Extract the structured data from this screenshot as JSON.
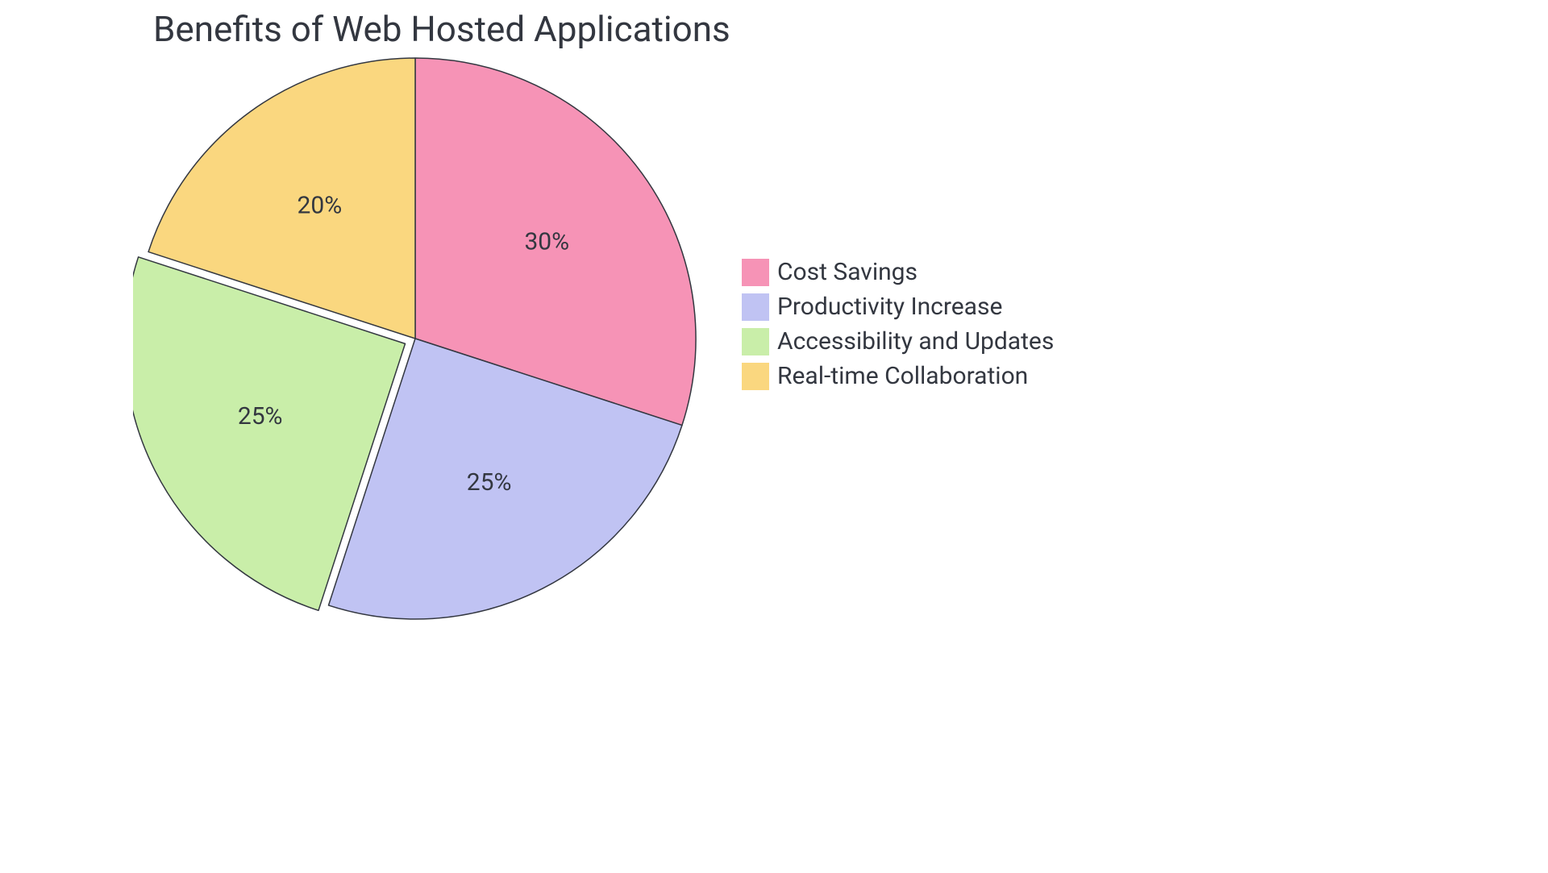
{
  "chart_data": {
    "type": "pie",
    "title": "Benefits of Web Hosted Applications",
    "series": [
      {
        "name": "Cost Savings",
        "value": 30,
        "label": "30%",
        "color": "#f693b6"
      },
      {
        "name": "Productivity Increase",
        "value": 25,
        "label": "25%",
        "color": "#c0c3f3"
      },
      {
        "name": "Accessibility and Updates",
        "value": 25,
        "label": "25%",
        "color": "#c9eea9"
      },
      {
        "name": "Real-time Collaboration",
        "value": 20,
        "label": "20%",
        "color": "#fad77f"
      }
    ],
    "stroke": "#333740",
    "pull_index": 2,
    "pull_amount": 14,
    "legend_position": "right"
  }
}
